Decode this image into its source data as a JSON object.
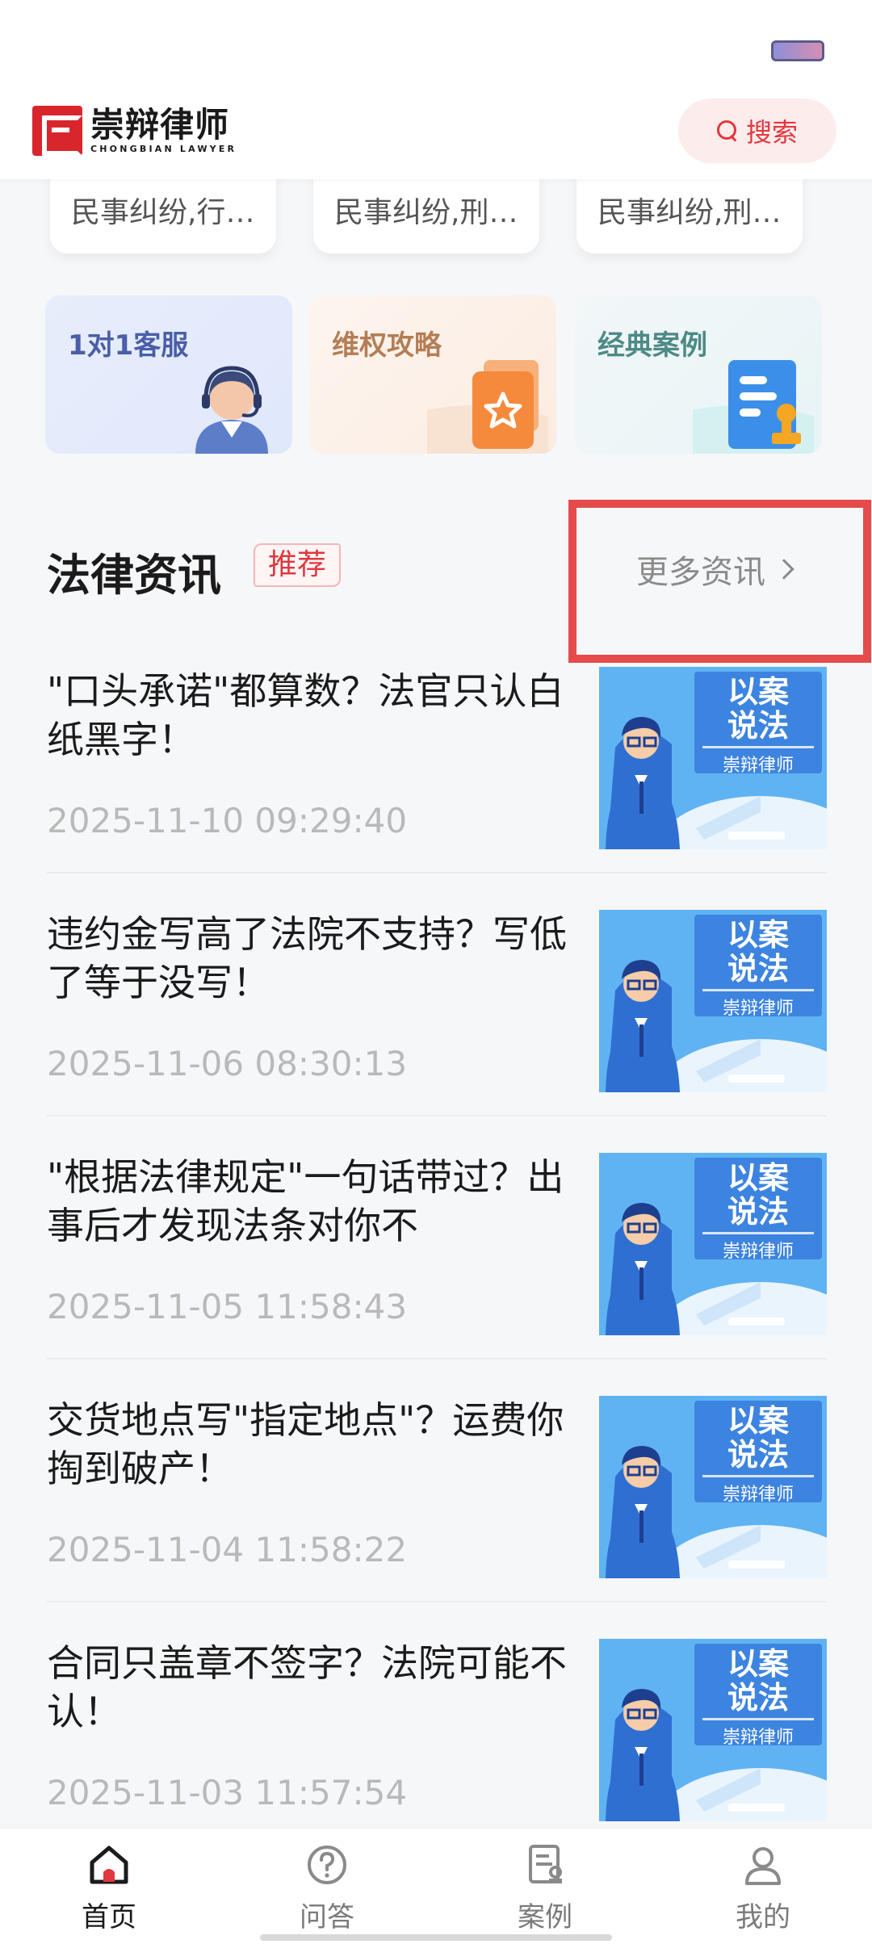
{
  "header": {
    "logo_cn": "崇辩律师",
    "logo_en": "CHONGBIAN LAWYER",
    "search_label": "搜索"
  },
  "category_cards": [
    "民事纠纷,行…",
    "民事纠纷,刑…",
    "民事纠纷,刑…"
  ],
  "service_tiles": [
    {
      "label": "1对1客服",
      "icon": "customer-service-agent-icon"
    },
    {
      "label": "维权攻略",
      "icon": "strategy-folder-icon"
    },
    {
      "label": "经典案例",
      "icon": "case-document-stamp-icon"
    }
  ],
  "news_section": {
    "title": "法律资讯",
    "badge": "推荐",
    "more_label": "更多资讯"
  },
  "thumbnail": {
    "line1": "以案",
    "line2": "说法",
    "caption": "崇辩律师"
  },
  "news": [
    {
      "title": "\"口头承诺\"都算数？法官只认白纸黑字！",
      "date": "2025-11-10 09:29:40"
    },
    {
      "title": "违约金写高了法院不支持？写低了等于没写！",
      "date": "2025-11-06 08:30:13"
    },
    {
      "title": "\"根据法律规定\"一句话带过？出事后才发现法条对你不",
      "date": "2025-11-05 11:58:43"
    },
    {
      "title": "交货地点写\"指定地点\"？运费你掏到破产！",
      "date": "2025-11-04 11:58:22"
    },
    {
      "title": "合同只盖章不签字？法院可能不认！",
      "date": "2025-11-03 11:57:54"
    }
  ],
  "tabbar": [
    {
      "label": "首页",
      "icon": "home-icon",
      "active": true
    },
    {
      "label": "问答",
      "icon": "question-icon",
      "active": false
    },
    {
      "label": "案例",
      "icon": "case-icon",
      "active": false
    },
    {
      "label": "我的",
      "icon": "profile-icon",
      "active": false
    }
  ],
  "colors": {
    "brand_red": "#e0383e",
    "highlight_border": "#e54b4b",
    "thumb_blue": "#55aef0"
  }
}
